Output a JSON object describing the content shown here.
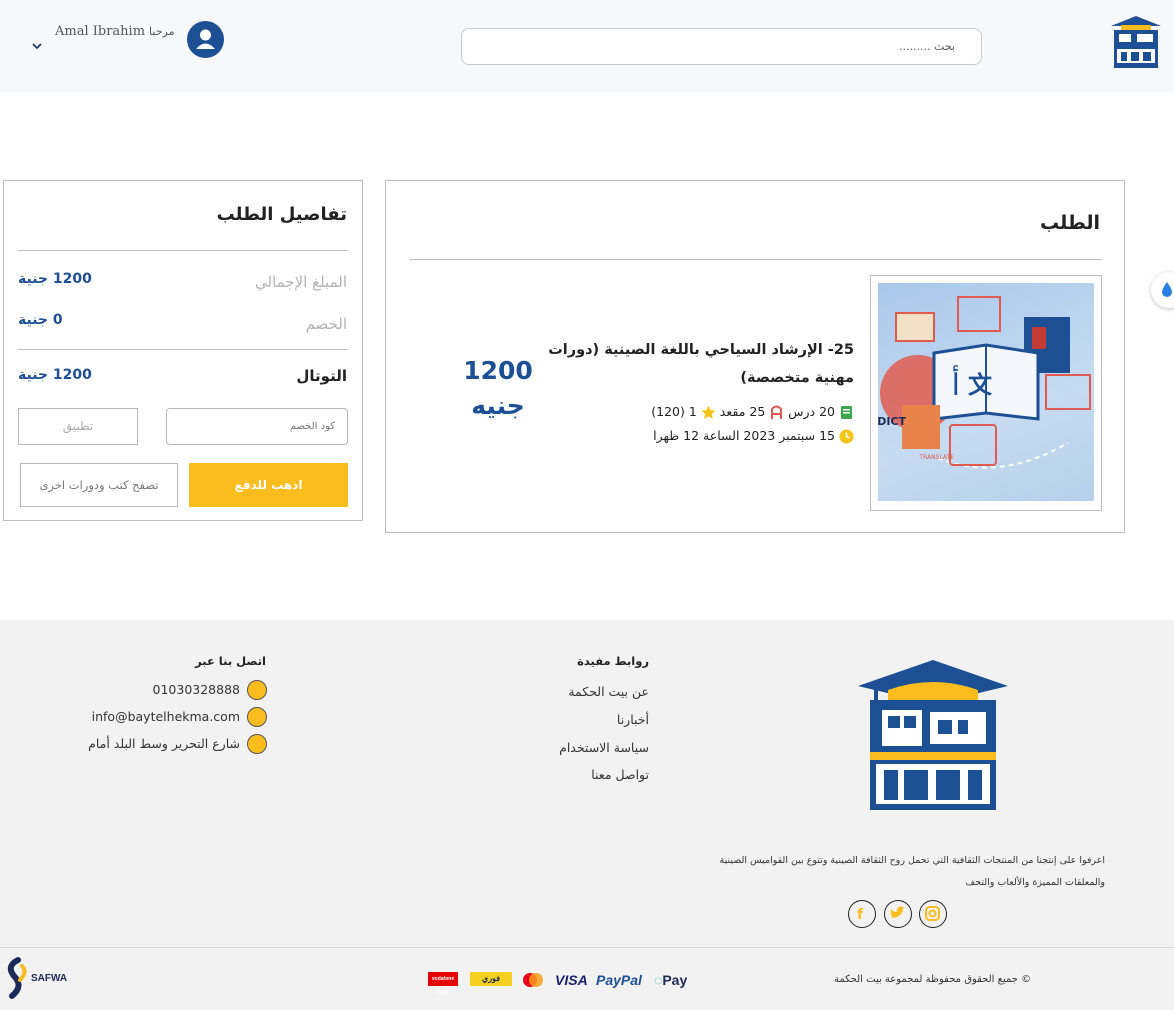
{
  "header": {
    "search_placeholder": "بحث .........",
    "welcome": "مرحبا",
    "user_name": "Amal Ibrahim"
  },
  "summary": {
    "title": "تفاصيل الطلب",
    "total_amount_label": "المبلغ الإجمالي",
    "total_amount_value": "1200 جنية",
    "discount_label": "الخصم",
    "discount_value": "0 جنية",
    "grand_total_label": "التوتال",
    "grand_total_value": "1200 جنية",
    "coupon_placeholder": "كود الخصم",
    "apply_label": "تطبيق",
    "pay_label": "اذهب للدفع",
    "browse_label": "تصفح كتب ودورات اخرى"
  },
  "order": {
    "title": "الطلب",
    "course_name": "25- الإرشاد السياحي باللغة الصينية (دورات مهنية متخصصة)",
    "lessons": "20 درس",
    "seats": "25 مقعد",
    "rating": "1 (120)",
    "date": "15 سبتمبر 2023 الساعة 12 ظهرا",
    "price_number": "1200",
    "price_currency": "جنيه"
  },
  "footer": {
    "about": "اعرفوا على إنتجنا من المنتجات الثقافية التي تحمل روح الثقافة الصينية وتتوع بين القواميس الصينية والمعلقات المميزة والألعاب والتحف",
    "links_title": "روابط مفيدة",
    "links": [
      "عن بيت الحكمة",
      "أخبارنا",
      "سياسة الاستخدام",
      "تواصل معنا"
    ],
    "contact_title": "اتصل بنا عبر",
    "phone": "01030328888",
    "email": "info@baytelhekma.com",
    "address": "شارع التحرير وسط البلد أمام",
    "copyright": "© جميع الحقوق محفوظة لمجموعة بيت الحكمة",
    "payment_methods": [
      "Pay",
      "PayPal",
      "VISA",
      "mastercard",
      "فوري",
      "vodafone cash"
    ],
    "partner": "SAFWA"
  },
  "colors": {
    "brand_blue": "#1c4f94",
    "accent_yellow": "#fbbc1e"
  }
}
